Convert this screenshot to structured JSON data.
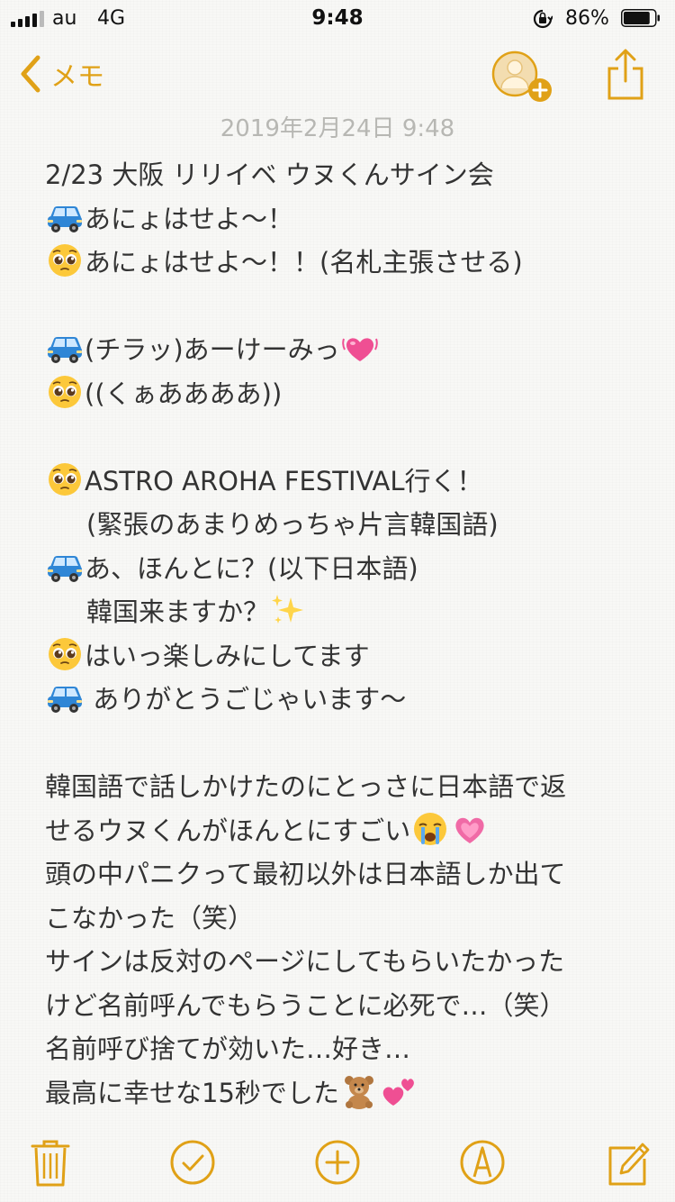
{
  "status_bar": {
    "carrier": "au",
    "network": "4G",
    "time": "9:48",
    "battery_percent": "86%",
    "battery_level": 0.86
  },
  "nav": {
    "back_label": "メモ",
    "accent_color": "#e0a117"
  },
  "note": {
    "date": "2019年2月24日 9:48",
    "lines": [
      {
        "text": "2/23 大阪 リリイベ ウヌくんサイン会",
        "lead": "",
        "trail": "",
        "indent": false
      },
      {
        "text": "あにょはせよ〜！",
        "lead": "car",
        "trail": "",
        "indent": false
      },
      {
        "text": "あにょはせよ〜！！(名札主張させる)",
        "lead": "pleading",
        "trail": "",
        "indent": false
      },
      {
        "text": "",
        "lead": "",
        "trail": "",
        "indent": false
      },
      {
        "text": "(チラッ)あーけーみっ",
        "lead": "car",
        "trail": "beating-heart",
        "indent": false
      },
      {
        "text": "((くぁああああ))",
        "lead": "pleading",
        "trail": "",
        "indent": false
      },
      {
        "text": "",
        "lead": "",
        "trail": "",
        "indent": false
      },
      {
        "text": "ASTRO AROHA FESTIVAL行く！",
        "lead": "pleading",
        "trail": "",
        "indent": false
      },
      {
        "text": "(緊張のあまりめっちゃ片言韓国語)",
        "lead": "",
        "trail": "",
        "indent": true
      },
      {
        "text": "あ、ほんとに？(以下日本語)",
        "lead": "car",
        "trail": "",
        "indent": false
      },
      {
        "text": "韓国来ますか？",
        "lead": "",
        "trail": "sparkles",
        "indent": true
      },
      {
        "text": "はいっ楽しみにしてます",
        "lead": "pleading",
        "trail": "",
        "indent": false
      },
      {
        "text": " ありがとうごじゃいます〜",
        "lead": "car",
        "trail": "",
        "indent": false
      },
      {
        "text": "",
        "lead": "",
        "trail": "",
        "indent": false
      },
      {
        "text": "韓国語で話しかけたのにとっさに日本語で返",
        "lead": "",
        "trail": "",
        "indent": false
      },
      {
        "text": "せるウヌくんがほんとにすごい",
        "lead": "",
        "trail": "crying-heart",
        "indent": false
      },
      {
        "text": "頭の中パニクって最初以外は日本語しか出て",
        "lead": "",
        "trail": "",
        "indent": false
      },
      {
        "text": "こなかった（笑）",
        "lead": "",
        "trail": "",
        "indent": false
      },
      {
        "text": "サインは反対のページにしてもらいたかった",
        "lead": "",
        "trail": "",
        "indent": false
      },
      {
        "text": "けど名前呼んでもらうことに必死で…（笑）",
        "lead": "",
        "trail": "",
        "indent": false
      },
      {
        "text": "名前呼び捨てが効いた…好き…",
        "lead": "",
        "trail": "",
        "indent": false
      },
      {
        "text": "最高に幸せな15秒でした",
        "lead": "",
        "trail": "bear-hearts",
        "indent": false
      }
    ]
  },
  "icons": {
    "lead_car": "car-icon",
    "lead_pleading": "pleading-face-icon",
    "trail_beating-heart": "beating-heart-icon",
    "trail_sparkles": "sparkles-icon",
    "trail_crying-heart": "crying-face-and-heart-icon",
    "trail_bear-hearts": "teddy-bear-and-hearts-icon"
  },
  "toolbar": {
    "items": [
      "trash-icon",
      "checklist-icon",
      "add-icon",
      "markup-icon",
      "compose-icon"
    ]
  }
}
